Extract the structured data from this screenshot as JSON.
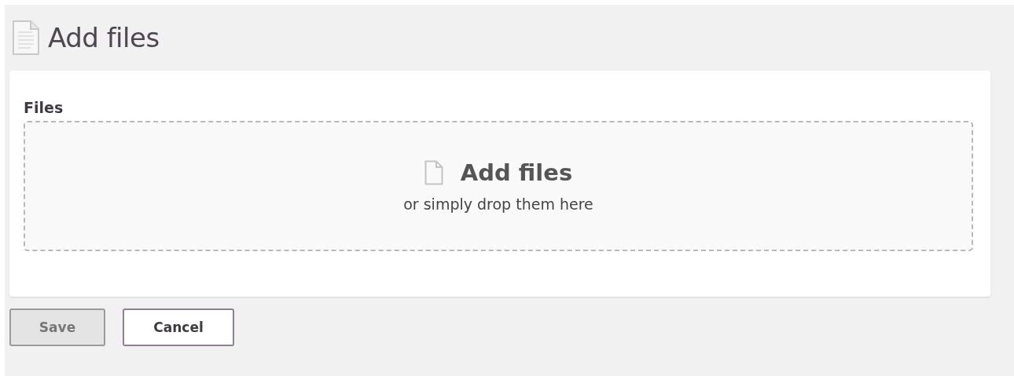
{
  "page": {
    "title": "Add files"
  },
  "form": {
    "field_label": "Files",
    "dropzone": {
      "title": "Add files",
      "hint": "or simply drop them here"
    }
  },
  "buttons": [
    {
      "label": "Save",
      "disabled": true
    },
    {
      "label": "Cancel",
      "disabled": false
    }
  ]
}
